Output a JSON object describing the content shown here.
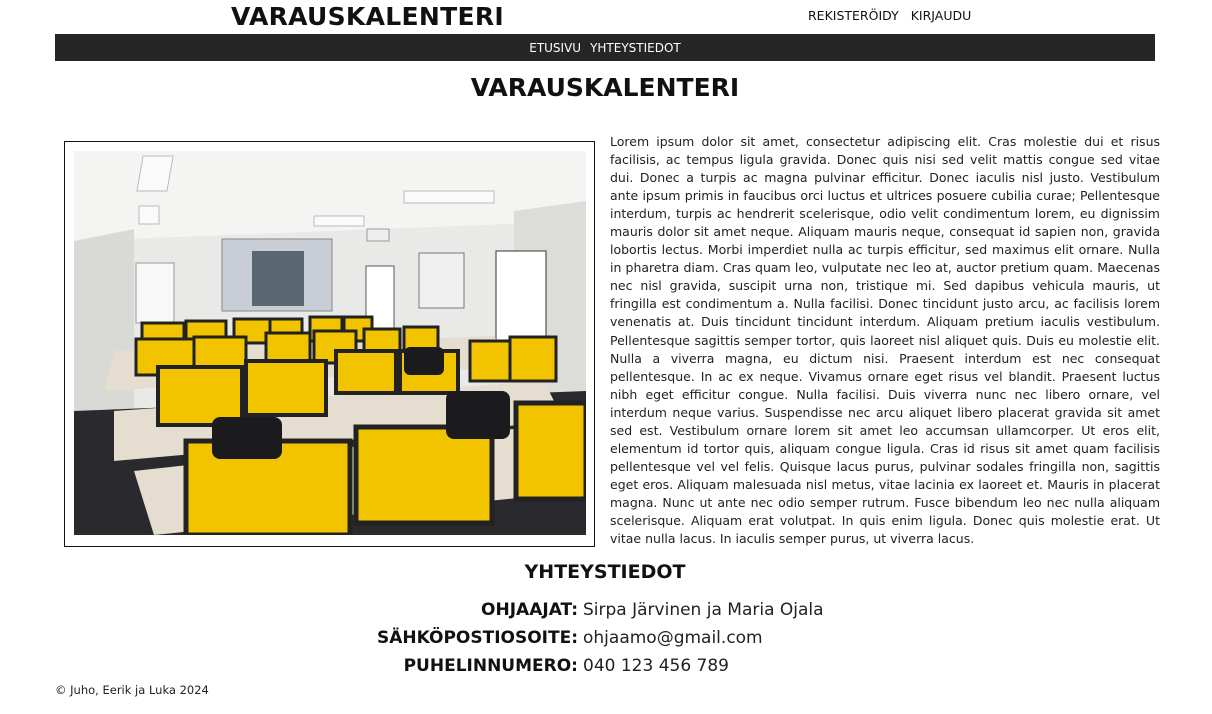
{
  "header": {
    "site_title": "VARAUSKALENTERI",
    "auth": {
      "register": "REKISTERÖIDY",
      "login": "KIRJAUDU"
    }
  },
  "nav": {
    "items": [
      "ETUSIVU",
      "YHTEYSTIEDOT"
    ]
  },
  "main": {
    "heading": "VARAUSKALENTERI",
    "paragraph": "Lorem ipsum dolor sit amet, consectetur adipiscing elit. Cras molestie dui et risus facilisis, ac tempus ligula gravida. Donec quis nisi sed velit mattis congue sed vitae dui. Donec a turpis ac magna pulvinar efficitur. Donec iaculis nisl justo. Vestibulum ante ipsum primis in faucibus orci luctus et ultrices posuere cubilia curae; Pellentesque interdum, turpis ac hendrerit scelerisque, odio velit condimentum lorem, eu dignissim mauris dolor sit amet neque. Aliquam mauris neque, consequat id sapien non, gravida lobortis lectus. Morbi imperdiet nulla ac turpis efficitur, sed maximus elit ornare. Nulla in pharetra diam. Cras quam leo, vulputate nec leo at, auctor pretium quam. Maecenas nec nisl gravida, suscipit urna non, tristique mi. Sed dapibus vehicula mauris, ut fringilla est condimentum a. Nulla facilisi. Donec tincidunt justo arcu, ac facilisis lorem venenatis at. Duis tincidunt tincidunt interdum. Aliquam pretium iaculis vestibulum. Pellentesque sagittis semper tortor, quis laoreet nisl aliquet quis. Duis eu molestie elit. Nulla a viverra magna, eu dictum nisi. Praesent interdum est nec consequat pellentesque. In ac ex neque. Vivamus ornare eget risus vel blandit. Praesent luctus nibh eget efficitur congue. Nulla facilisi. Duis viverra nunc nec libero ornare, vel interdum neque varius. Suspendisse nec arcu aliquet libero placerat gravida sit amet sed est. Vestibulum ornare lorem sit amet leo accumsan ullamcorper. Ut eros elit, elementum id tortor quis, aliquam congue ligula. Cras id risus sit amet quam facilisis pellentesque vel vel felis. Quisque lacus purus, pulvinar sodales fringilla non, sagittis eget eros. Aliquam malesuada nisl metus, vitae lacinia ex laoreet et. Mauris in placerat magna. Nunc ut ante nec odio semper rutrum. Fusce bibendum leo nec nulla aliquam scelerisque. Aliquam erat volutpat. In quis enim ligula. Donec quis molestie erat. Ut vitae nulla lacus. In iaculis semper purus, ut viverra lacus."
  },
  "contact": {
    "heading": "YHTEYSTIEDOT",
    "rows": [
      {
        "label": "OHJAAJAT:",
        "value": "Sirpa Järvinen ja Maria Ojala"
      },
      {
        "label": "SÄHKÖPOSTIOSOITE:",
        "value": "ohjaamo@gmail.com"
      },
      {
        "label": "PUHELINNUMERO:",
        "value": "040 123 456 789"
      }
    ]
  },
  "footer": {
    "text": "© Juho, Eerik ja Luka 2024"
  },
  "colors": {
    "navbar_bg": "#262626",
    "monitor_screen": "#f2c400"
  }
}
